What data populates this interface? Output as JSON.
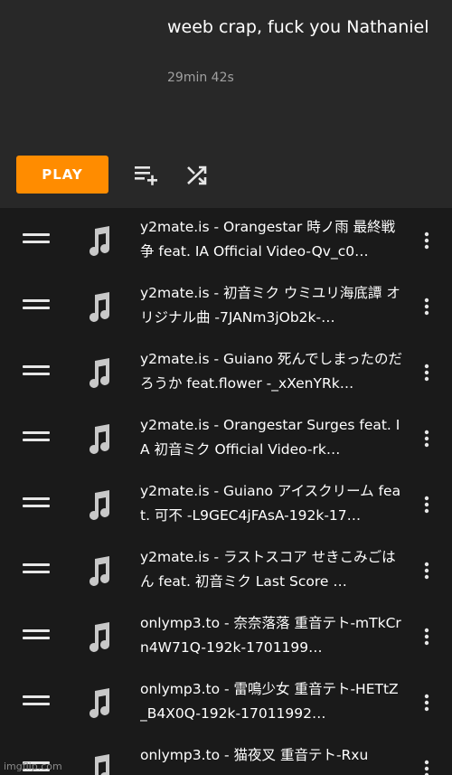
{
  "playlist": {
    "title": "weeb crap, fuck you Nathaniel",
    "duration": "29min 42s"
  },
  "actions": {
    "play_label": "PLAY",
    "add_to_queue_icon": "playlist-add-icon",
    "shuffle_icon": "shuffle-icon"
  },
  "tracks": [
    {
      "title": "y2mate.is - Orangestar 時ノ雨 最終戦争 feat. IA Official Video-Qv_c0…"
    },
    {
      "title": "y2mate.is -  初音ミク ウミユリ海底譚 オリジナル曲 -7JANm3jOb2k-…"
    },
    {
      "title": "y2mate.is - Guiano 死んでしまったのだろうか feat.flower -_xXenYRk…"
    },
    {
      "title": "y2mate.is - Orangestar Surges feat. IA 初音ミク Official Video-rk…"
    },
    {
      "title": "y2mate.is - Guiano アイスクリーム feat. 可不 -L9GEC4jFAsA-192k-17…"
    },
    {
      "title": "y2mate.is - ラストスコア せきこみごはん feat. 初音ミク Last Score …"
    },
    {
      "title": "onlymp3.to - 奈奈落落 重音テト-mTkCrn4W71Q-192k-1701199…"
    },
    {
      "title": "onlymp3.to - 雷鳴少女 重音テト-HETtZ_B4X0Q-192k-17011992…"
    },
    {
      "title": "onlymp3.to - 猫夜叉 重音テト-Rxu"
    }
  ],
  "watermark": "imgflip.com",
  "colors": {
    "accent": "#ff8c00",
    "header_bg": "#282828",
    "list_bg": "#1a1a1a",
    "secondary_text": "#a0a0a0"
  }
}
